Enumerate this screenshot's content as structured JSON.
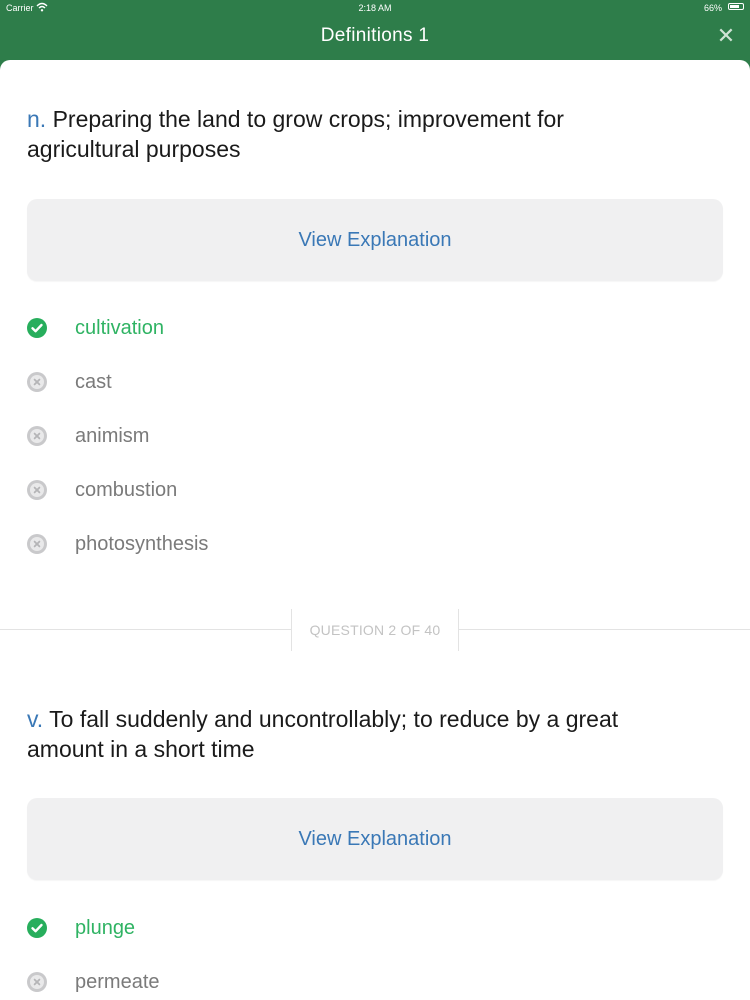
{
  "status_bar": {
    "carrier": "Carrier",
    "time": "2:18 AM",
    "battery": "66%",
    "wifi_icon": "wifi-icon",
    "battery_icon": "battery-icon"
  },
  "nav": {
    "title": "Definitions 1",
    "close_icon": "close-icon",
    "background_color": "#2e7d4a"
  },
  "questions": [
    {
      "part_of_speech": "n.",
      "definition": " Preparing the land to grow crops; improvement for agricultural purposes",
      "explain_label": "View Explanation",
      "options": [
        {
          "label": "cultivation",
          "state": "correct"
        },
        {
          "label": "cast",
          "state": "wrong"
        },
        {
          "label": "animism",
          "state": "wrong"
        },
        {
          "label": "combustion",
          "state": "wrong"
        },
        {
          "label": "photosynthesis",
          "state": "wrong"
        }
      ]
    },
    {
      "part_of_speech": "v.",
      "definition": " To fall suddenly and uncontrollably; to reduce by a great amount in a short time",
      "explain_label": "View Explanation",
      "options": [
        {
          "label": "plunge",
          "state": "correct"
        },
        {
          "label": "permeate",
          "state": "wrong"
        }
      ]
    }
  ],
  "progress": {
    "label": "QUESTION 2 OF 40",
    "current": 2,
    "total": 40
  },
  "colors": {
    "correct": "#2fb363",
    "accent_blue": "#3a78b6",
    "wrong_icon": "#c9c9cb"
  }
}
